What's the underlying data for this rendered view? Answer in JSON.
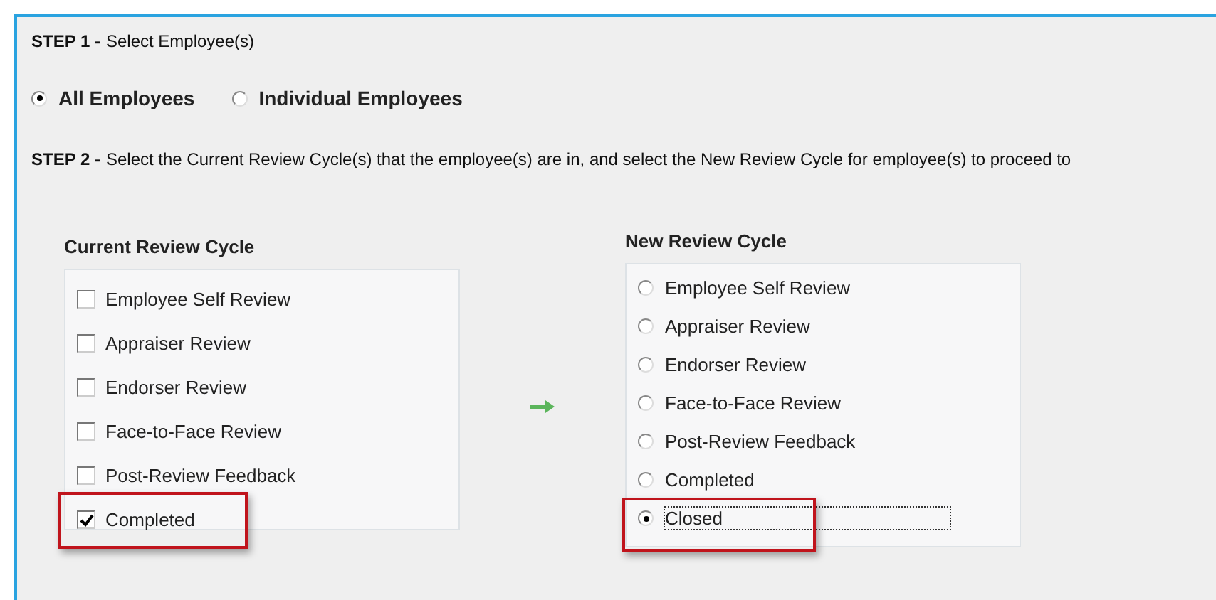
{
  "step1": {
    "label": "STEP 1 -",
    "text": "Select Employee(s)"
  },
  "employee_scope": [
    {
      "label": "All Employees",
      "selected": true
    },
    {
      "label": "Individual Employees",
      "selected": false
    }
  ],
  "step2": {
    "label": "STEP 2 -",
    "text": "Select the Current Review Cycle(s) that the employee(s) are in, and select the New Review Cycle for employee(s) to proceed to"
  },
  "current_review_cycle": {
    "title": "Current Review Cycle",
    "items": [
      {
        "label": "Employee Self Review",
        "checked": false,
        "highlighted": false
      },
      {
        "label": "Appraiser Review",
        "checked": false,
        "highlighted": false
      },
      {
        "label": "Endorser Review",
        "checked": false,
        "highlighted": false
      },
      {
        "label": "Face-to-Face Review",
        "checked": false,
        "highlighted": false
      },
      {
        "label": "Post-Review Feedback",
        "checked": false,
        "highlighted": false
      },
      {
        "label": "Completed",
        "checked": true,
        "highlighted": true
      }
    ]
  },
  "new_review_cycle": {
    "title": "New Review Cycle",
    "items": [
      {
        "label": "Employee Self Review",
        "selected": false,
        "highlighted": false,
        "focused": false
      },
      {
        "label": "Appraiser Review",
        "selected": false,
        "highlighted": false,
        "focused": false
      },
      {
        "label": "Endorser Review",
        "selected": false,
        "highlighted": false,
        "focused": false
      },
      {
        "label": "Face-to-Face Review",
        "selected": false,
        "highlighted": false,
        "focused": false
      },
      {
        "label": "Post-Review Feedback",
        "selected": false,
        "highlighted": false,
        "focused": false
      },
      {
        "label": "Completed",
        "selected": false,
        "highlighted": false,
        "focused": false
      },
      {
        "label": "Closed",
        "selected": true,
        "highlighted": true,
        "focused": true
      }
    ]
  }
}
